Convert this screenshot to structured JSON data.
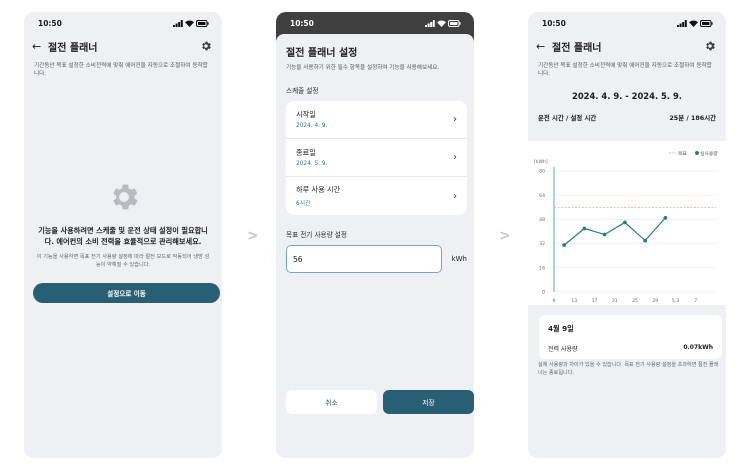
{
  "screen1": {
    "time": "10:50",
    "title": "절전 플래너",
    "description": "기간동안 목표 설정한 소비전력에 맞춰 에어컨을 자동으로 조절하여 동작합니다.",
    "empty_title": "기능을 사용하려면 스케줄 및 운전 상태 설정이 필요합니다. 에어컨의 소비 전력을 효율적으로 관리해보세요.",
    "empty_subtitle": "이 기능을 사용하면 목표 전기 사용량 설정에 따라 절전 모드로 작동되어 냉방 성능이 약해질 수 있습니다.",
    "primary_button": "설정으로 이동"
  },
  "screen2": {
    "time": "10:50",
    "title": "절전 플래너 설정",
    "description": "기능을 사용하기 위한 필수 항목을 설정하여 기능을 사용해보세요.",
    "schedule_section": "스케줄 설정",
    "schedule_items": [
      {
        "label": "시작일",
        "value": "2024. 4. 9."
      },
      {
        "label": "종료일",
        "value": "2024. 5. 9."
      },
      {
        "label": "하루 사용 시간",
        "value": "6시간"
      }
    ],
    "target_section": "목표 전기 사용량 설정",
    "target_value": "56",
    "target_unit": "kWh",
    "cancel_button": "취소",
    "save_button": "저장"
  },
  "screen3": {
    "time": "10:50",
    "title": "절전 플래너",
    "description": "기간동안 목표 설정한 소비전력에 맞춰 에어컨을 자동으로 조절하여 동작합니다.",
    "date_range": "2024. 4. 9. - 2024. 5. 9.",
    "usage_label": "운전 시간 / 설정 시간",
    "usage_value": "25분 / 186시간",
    "detail_date": "4월 9일",
    "detail_label": "전력 사용량",
    "detail_value": "0.07kWh",
    "footnote": "실제 사용량과 차이가 있을 수 있습니다. 목표 전기 사용량 설정을 초과하면 절전 플래너는 종료됩니다."
  },
  "chart_data": {
    "type": "line",
    "ylabel": "[kWh]",
    "ylim": [
      0,
      80
    ],
    "yticks": [
      "0",
      "16",
      "32",
      "48",
      "64",
      "80"
    ],
    "x_tick_labels": [
      "9",
      "13",
      "17",
      "21",
      "25",
      "29",
      "5.3",
      "7"
    ],
    "goal_value": 56,
    "series": [
      {
        "name": "목표",
        "style": "dashed",
        "color": "#e89a7a"
      },
      {
        "name": "실사용량",
        "color": "#2a7a8e",
        "x_index": [
          0.5,
          1.5,
          2.5,
          3.5,
          4.5,
          5.5
        ],
        "values": [
          31,
          42,
          38,
          46,
          34,
          49
        ]
      }
    ],
    "legend": [
      "목표",
      "실사용량"
    ]
  },
  "colors": {
    "accent": "#285f75",
    "teal": "#2a7a8e",
    "target_line": "#e89a7a",
    "background": "#eff0f4"
  }
}
